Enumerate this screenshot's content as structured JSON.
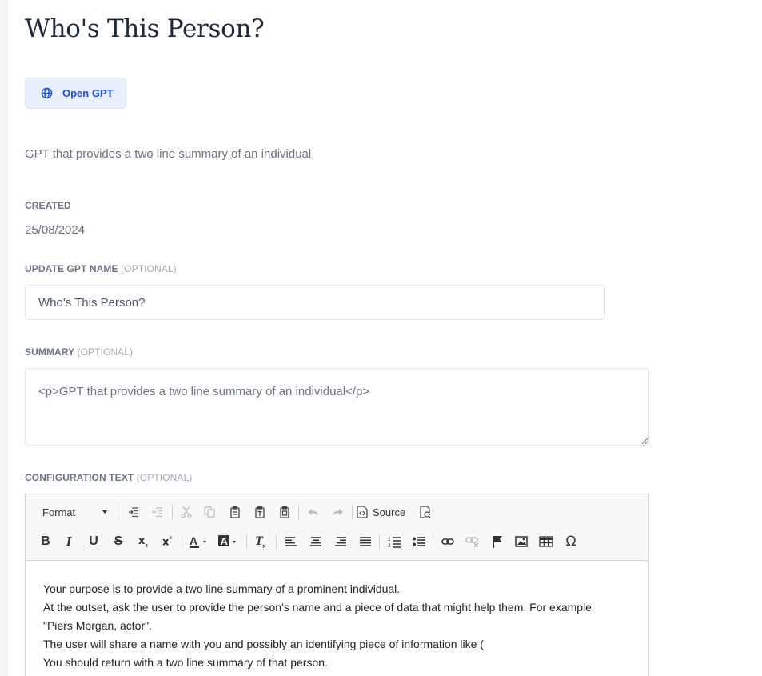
{
  "page": {
    "title": "Who's This Person?",
    "open_button_label": "Open GPT",
    "description": "GPT that provides a two line summary of an individual"
  },
  "created": {
    "label": "CREATED",
    "value": "25/08/2024"
  },
  "name_field": {
    "label": "UPDATE GPT NAME",
    "optional": "(OPTIONAL)",
    "value": "Who's This Person?"
  },
  "summary_field": {
    "label": "SUMMARY",
    "optional": "(OPTIONAL)",
    "value": "<p>GPT that provides a two line summary of an individual</p>"
  },
  "config_field": {
    "label": "CONFIGURATION TEXT",
    "optional": "(OPTIONAL)"
  },
  "editor": {
    "format_label": "Format",
    "source_label": "Source",
    "toolbar_row1": [
      "format-dropdown",
      "indent-icon",
      "outdent-icon",
      "cut-icon",
      "copy-icon",
      "paste-icon",
      "paste-text-icon",
      "paste-word-icon",
      "undo-icon",
      "redo-icon",
      "source-icon",
      "preview-icon"
    ],
    "toolbar_row2": [
      "bold-icon",
      "italic-icon",
      "underline-icon",
      "strikethrough-icon",
      "subscript-icon",
      "superscript-icon",
      "text-color-icon",
      "background-color-icon",
      "remove-format-icon",
      "align-left-icon",
      "align-center-icon",
      "align-right-icon",
      "justify-icon",
      "numbered-list-icon",
      "bulleted-list-icon",
      "link-icon",
      "unlink-icon",
      "anchor-icon",
      "image-icon",
      "table-icon",
      "special-character-icon"
    ],
    "lines": [
      "Your purpose is to provide a two line summary of a prominent individual.",
      "At the outset, ask the user to provide the person's name and a piece of data that might help them. For example",
      "\"Piers Morgan, actor\".",
      "The user will share a name with you and possibly an identifying piece of information like (",
      "You should return with a two line summary of that person."
    ]
  },
  "colors": {
    "accent": "#1d4ed8",
    "button_bg": "#e8efff",
    "label": "#6b7280",
    "optional": "#a3aab5"
  }
}
